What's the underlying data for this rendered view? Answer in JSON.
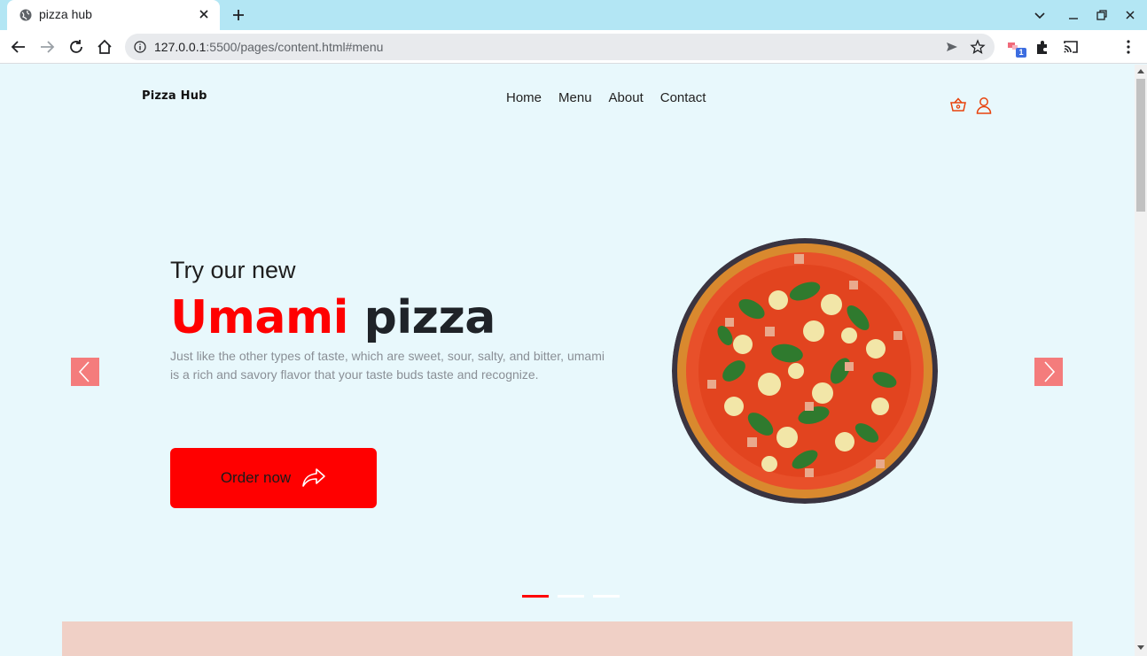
{
  "browser": {
    "tab_title": "pizza hub",
    "url_host": "127.0.0.1",
    "url_rest": ":5500/pages/content.html#menu",
    "extension_badge": "1"
  },
  "site": {
    "logo": "Pizza Hub",
    "nav": [
      "Home",
      "Menu",
      "About",
      "Contact"
    ]
  },
  "hero": {
    "kicker": "Try our new",
    "title_accent": "Umami",
    "title_rest": "pizza",
    "description": "Just like the other types of taste, which are sweet, sour, salty, and bitter, umami is a rich and savory flavor that your taste buds taste and recognize.",
    "cta": "Order now",
    "active_slide": 1,
    "slide_count": 3
  },
  "colors": {
    "accent": "#ff0000",
    "arrow_bg": "#f47c7c",
    "page_bg": "#e8f8fc",
    "section_bg": "#f0d0c6"
  },
  "icons": {
    "cart": "basket-icon",
    "account": "user-icon",
    "cta": "share-arrow-icon",
    "prev": "chevron-left-icon",
    "next": "chevron-right-icon"
  }
}
